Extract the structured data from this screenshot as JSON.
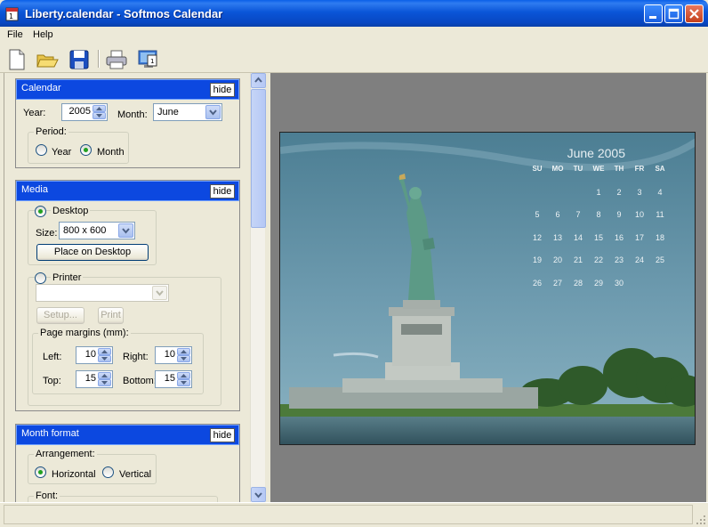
{
  "window": {
    "title": "Liberty.calendar - Softmos Calendar"
  },
  "menu": {
    "file": "File",
    "help": "Help"
  },
  "toolbar": {
    "icons": [
      "new-document-icon",
      "open-folder-icon",
      "save-disk-icon",
      "print-icon",
      "desktop-monitor-icon"
    ]
  },
  "calendar_section": {
    "title": "Calendar",
    "hide_label": "hide",
    "year_label": "Year:",
    "year_value": "2005",
    "month_label": "Month:",
    "month_value": "June",
    "period_label": "Period:",
    "period_options": [
      "Year",
      "Month"
    ],
    "period_selected": "Month"
  },
  "media_section": {
    "title": "Media",
    "hide_label": "hide",
    "desktop_label": "Desktop",
    "desktop_selected": true,
    "size_label": "Size:",
    "size_value": "800 x 600",
    "place_button": "Place on Desktop",
    "printer_label": "Printer",
    "printer_value": "",
    "setup_button": "Setup...",
    "print_button": "Print",
    "margins_label": "Page margins (mm):",
    "left_label": "Left:",
    "left_value": "10",
    "right_label": "Right:",
    "right_value": "10",
    "top_label": "Top:",
    "top_value": "15",
    "bottom_label": "Bottom:",
    "bottom_value": "15"
  },
  "month_format_section": {
    "title": "Month format",
    "hide_label": "hide",
    "arrangement_label": "Arrangement:",
    "arrangement_options": [
      "Horizontal",
      "Vertical"
    ],
    "arrangement_selected": "Horizontal",
    "font_label": "Font:"
  },
  "preview": {
    "month_title": "June 2005",
    "weekdays": [
      "SU",
      "MO",
      "TU",
      "WE",
      "TH",
      "FR",
      "SA"
    ],
    "weeks": [
      [
        "",
        "",
        "",
        "1",
        "2",
        "3",
        "4"
      ],
      [
        "5",
        "6",
        "7",
        "8",
        "9",
        "10",
        "11"
      ],
      [
        "12",
        "13",
        "14",
        "15",
        "16",
        "17",
        "18"
      ],
      [
        "19",
        "20",
        "21",
        "22",
        "23",
        "24",
        "25"
      ],
      [
        "26",
        "27",
        "28",
        "29",
        "30",
        "",
        ""
      ]
    ]
  },
  "colors": {
    "titlebar": "#0a55d8",
    "section_header": "#0c48e0",
    "preview_bg": "#7f7f7f",
    "radio_dot": "#21a121"
  }
}
